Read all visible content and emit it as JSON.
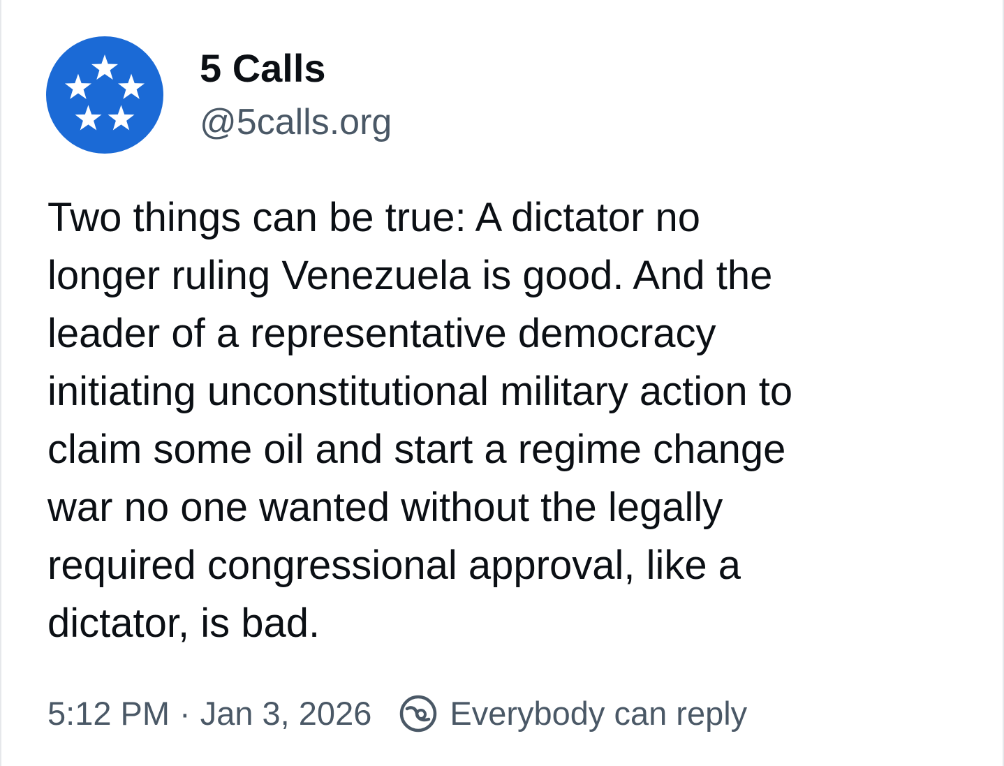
{
  "post": {
    "author": {
      "display_name": "5 Calls",
      "handle": "@5calls.org",
      "avatar_color": "#1b6ad6",
      "avatar_icon": "five-stars-logo-icon"
    },
    "text": "Two things can be true: A dictator no\nlonger ruling Venezuela is good. And the\nleader of a representative democracy\ninitiating unconstitutional military action to\nclaim some oil and start a regime change\nwar no one wanted without the legally\nrequired congressional approval, like a\ndictator, is bad.",
    "time": "5:12 PM",
    "separator": "·",
    "date": "Jan 3, 2026",
    "reply_setting": {
      "icon": "reply-everyone-icon",
      "label": "Everybody can reply"
    }
  }
}
